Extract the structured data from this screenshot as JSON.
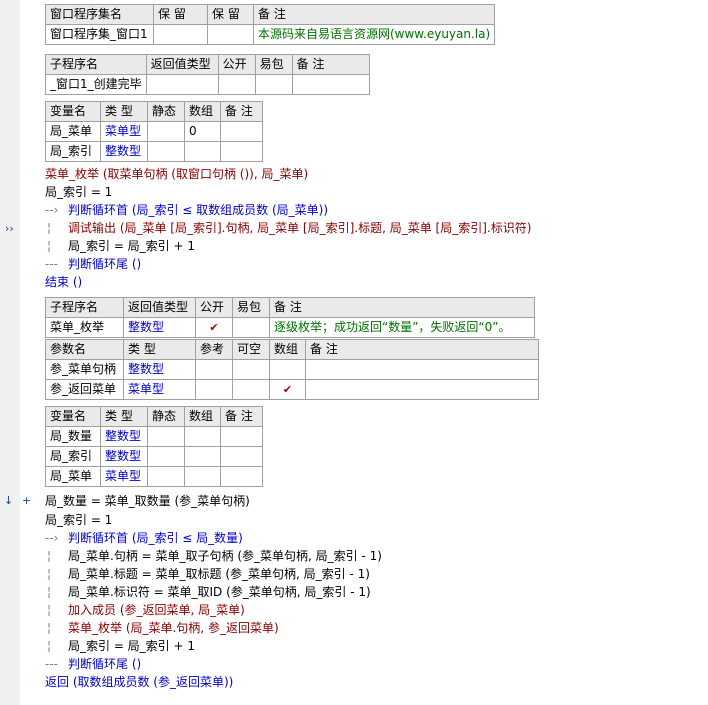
{
  "window_table": {
    "headers": [
      "窗口程序集名",
      "保 留",
      "保 留",
      "备 注"
    ],
    "name": "窗口程序集_窗口1",
    "note": "本源码来自易语言资源网(www.eyuyan.la)"
  },
  "sub1_table": {
    "headers": [
      "子程序名",
      "返回值类型",
      "公开",
      "易包",
      "备 注"
    ],
    "name": "_窗口1_创建完毕"
  },
  "sub1_vars": {
    "headers": [
      "变量名",
      "类 型",
      "静态",
      "数组",
      "备 注"
    ],
    "rows": [
      {
        "name": "局_菜单",
        "type": "菜单型",
        "array": "0"
      },
      {
        "name": "局_索引",
        "type": "整数型",
        "array": ""
      }
    ]
  },
  "code1": [
    "菜单_枚举 (取菜单句柄 (取窗口句柄 ()), 局_菜单)",
    "局_索引 = 1",
    "判断循环首 (局_索引 ≤ 取数组成员数 (局_菜单))",
    "调试输出 (局_菜单 [局_索引].句柄, 局_菜单 [局_索引].标题, 局_菜单 [局_索引].标识符)",
    "局_索引 = 局_索引 + 1",
    "判断循环尾 ()",
    "结束 ()"
  ],
  "sub2_table": {
    "headers": [
      "子程序名",
      "返回值类型",
      "公开",
      "易包",
      "备 注"
    ],
    "name": "菜单_枚举",
    "ret_type": "整数型",
    "public_check": "✔",
    "note": "逐级枚举；成功返回“数量”，失败返回“0”。",
    "param_headers": [
      "参数名",
      "类 型",
      "参考",
      "可空",
      "数组",
      "备 注"
    ],
    "params": [
      {
        "name": "参_菜单句柄",
        "type": "整数型",
        "array": ""
      },
      {
        "name": "参_返回菜单",
        "type": "菜单型",
        "array": "✔"
      }
    ]
  },
  "sub2_vars": {
    "headers": [
      "变量名",
      "类 型",
      "静态",
      "数组",
      "备 注"
    ],
    "rows": [
      {
        "name": "局_数量",
        "type": "整数型"
      },
      {
        "name": "局_索引",
        "type": "整数型"
      },
      {
        "name": "局_菜单",
        "type": "菜单型"
      }
    ]
  },
  "code2": [
    "局_数量 = 菜单_取数量 (参_菜单句柄)",
    "局_索引 = 1",
    "判断循环首 (局_索引 ≤ 局_数量)",
    "局_菜单.句柄 = 菜单_取子句柄 (参_菜单句柄, 局_索引 - 1)",
    "局_菜单.标题 = 菜单_取标题 (参_菜单句柄, 局_索引 - 1)",
    "局_菜单.标识符 = 菜单_取ID (参_菜单句柄, 局_索引 - 1)",
    "加入成员 (参_返回菜单, 局_菜单)",
    "菜单_枚举 (局_菜单.句柄, 参_返回菜单)",
    "局_索引 = 局_索引 + 1",
    "判断循环尾 ()",
    "返回 (取数组成员数 (参_返回菜单))"
  ],
  "gutter": {
    "exec_marker": "››",
    "current_marker": "↓",
    "add_marker": "+"
  },
  "colors": {
    "keyword": "#0000cc",
    "command": "#8b0000",
    "note": "#007000",
    "selection": "#3d6ec9"
  }
}
